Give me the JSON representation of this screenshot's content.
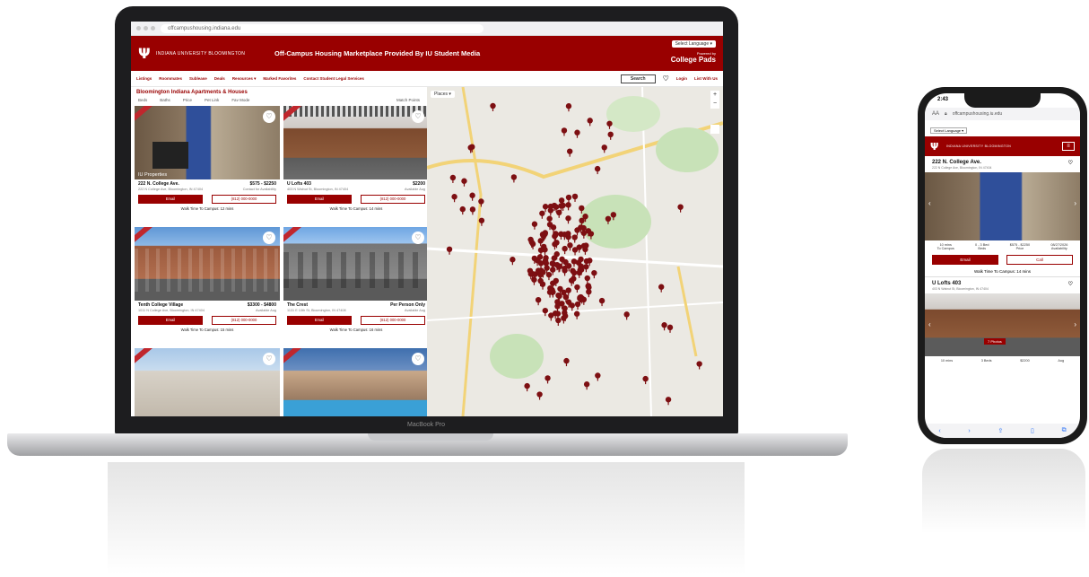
{
  "laptop": {
    "brand_label": "MacBook Pro",
    "browser": {
      "url": "offcampushousing.indiana.edu"
    },
    "header": {
      "university": "INDIANA UNIVERSITY BLOOMINGTON",
      "title": "Off-Campus Housing Marketplace Provided By IU Student Media",
      "language": "Select Language ▾",
      "powered_by": "Powered by",
      "brand": "College Pads"
    },
    "nav": {
      "items": [
        "Listings",
        "Roommates",
        "Sublease",
        "Deals",
        "Resources ▾",
        "Marked Favorites",
        "Contact Student Legal Services"
      ],
      "search": "Search",
      "login": "Login",
      "list_with_us": "List With Us"
    },
    "listing": {
      "heading": "Bloomington Indiana Apartments & Houses",
      "filters": [
        "Beds",
        "Baths",
        "Price",
        "Pet Link",
        "Fav Mode"
      ],
      "sort": "Match Points",
      "cards": [
        {
          "name": "222 N. College Ave.",
          "price": "$575 - $2250",
          "address": "222 N College Ave, Bloomington, IN 47404",
          "avail": "Contact for Availability",
          "email": "Email",
          "call": "(812) 000-0000",
          "walk": "Walk Time To Campus: 12 mins",
          "photo_label": "IU Properties"
        },
        {
          "name": "U Lofts 403",
          "price": "$2200",
          "address": "403 N Walnut St, Bloomington, IN 47404",
          "avail": "Available Aug",
          "email": "Email",
          "call": "(812) 000-0000",
          "walk": "Walk Time To Campus: 14 mins",
          "photo_label": ""
        },
        {
          "name": "Tenth College Village",
          "price": "$3300 - $4800",
          "address": "1011 N College Ave, Bloomington, IN 47404",
          "avail": "Available Aug",
          "email": "Email",
          "call": "(812) 000-0000",
          "walk": "Walk Time To Campus: 15 mins",
          "photo_label": ""
        },
        {
          "name": "The Crest",
          "price": "Per Person Only",
          "address": "1131 E 10th St, Bloomington, IN 47408",
          "avail": "Available Aug",
          "email": "Email",
          "call": "(812) 000-0000",
          "walk": "Walk Time To Campus: 16 mins",
          "photo_label": ""
        },
        {
          "name": "",
          "price": "",
          "address": "",
          "avail": "",
          "email": "",
          "call": "",
          "walk": "",
          "photo_label": ""
        },
        {
          "name": "",
          "price": "",
          "address": "",
          "avail": "",
          "email": "",
          "call": "",
          "walk": "",
          "photo_label": ""
        }
      ]
    },
    "map": {
      "type_button": "Places ▾",
      "zoom_in": "+",
      "zoom_out": "−"
    }
  },
  "phone": {
    "time": "2:43",
    "url": "offcampushousing.iu.edu",
    "language": "Select Language ▾",
    "university": "INDIANA UNIVERSITY BLOOMINGTON",
    "listings": [
      {
        "name": "222 N. College Ave.",
        "address": "222 N College Ave, Bloomington, IN 47404",
        "stats": [
          {
            "value": "10 mins",
            "label": "To Campus"
          },
          {
            "value": "0 - 3 Bed",
            "label": "Beds"
          },
          {
            "value": "$575 - $2250",
            "label": "Price"
          },
          {
            "value": "08/27/2026",
            "label": "Availability"
          }
        ],
        "email": "Email",
        "call": "Call",
        "walk": "Walk Time To Campus: 14 mins"
      },
      {
        "name": "U Lofts 403",
        "address": "403 N Walnut St, Bloomington, IN 47404",
        "photo_badge": "7 Photos",
        "stats": [
          {
            "value": "10 mins",
            "label": ""
          },
          {
            "value": "3 Beds",
            "label": ""
          },
          {
            "value": "$2200",
            "label": ""
          },
          {
            "value": "Aug",
            "label": ""
          }
        ]
      }
    ]
  }
}
